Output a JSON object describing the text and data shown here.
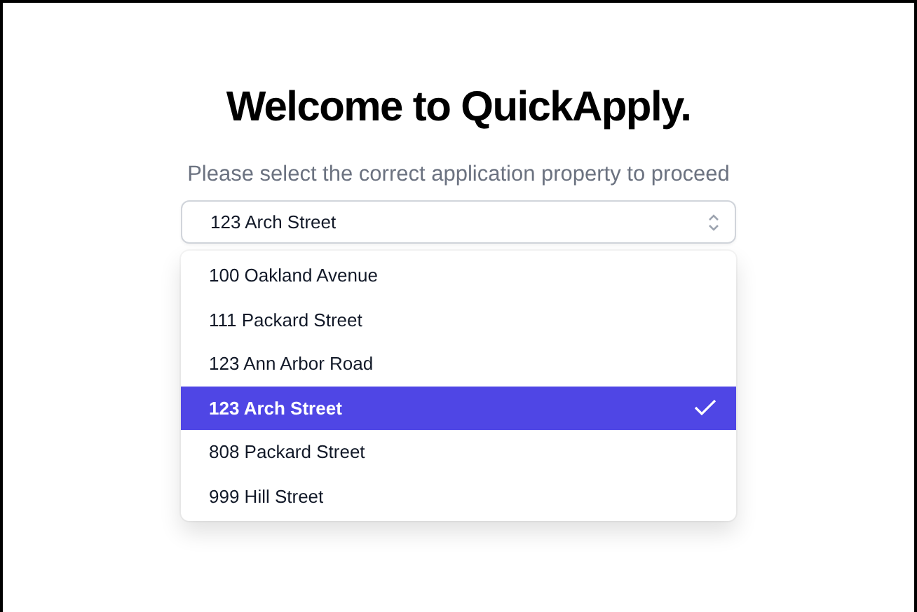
{
  "title": "Welcome to QuickApply.",
  "subtitle": "Please select the correct application property to proceed",
  "select": {
    "value": "123 Arch Street"
  },
  "options": [
    {
      "label": "100 Oakland Avenue",
      "selected": false
    },
    {
      "label": "111 Packard Street",
      "selected": false
    },
    {
      "label": "123 Ann Arbor Road",
      "selected": false
    },
    {
      "label": "123 Arch Street",
      "selected": true
    },
    {
      "label": "808 Packard Street",
      "selected": false
    },
    {
      "label": "999 Hill Street",
      "selected": false
    }
  ]
}
